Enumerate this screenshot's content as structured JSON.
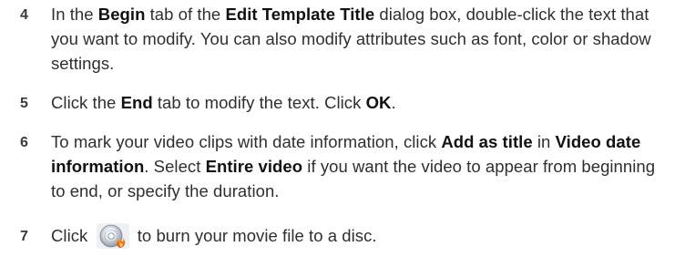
{
  "steps": [
    {
      "number": "4",
      "parts": [
        "In the ",
        "Begin",
        " tab of the ",
        "Edit Template Title",
        " dialog box, double-click the text that you want to modify. You can also modify attributes such as font, color or shadow settings."
      ]
    },
    {
      "number": "5",
      "parts": [
        "Click the ",
        "End",
        " tab to modify the text. Click ",
        "OK",
        "."
      ]
    },
    {
      "number": "6",
      "parts": [
        "To mark your video clips with date information, click ",
        "Add as title",
        " in ",
        "Video date information",
        ". Select ",
        "Entire video",
        " if you want the video to appear from beginning to end, or specify the duration."
      ]
    },
    {
      "number": "7",
      "parts": [
        "Click ",
        " to burn your movie file to a disc."
      ],
      "icon": "burn-disc-icon"
    }
  ],
  "colors": {
    "text": "#2f2f2f",
    "keyword": "#111111",
    "icon_disc": "#c9ced6",
    "icon_flame": "#e8641b"
  }
}
